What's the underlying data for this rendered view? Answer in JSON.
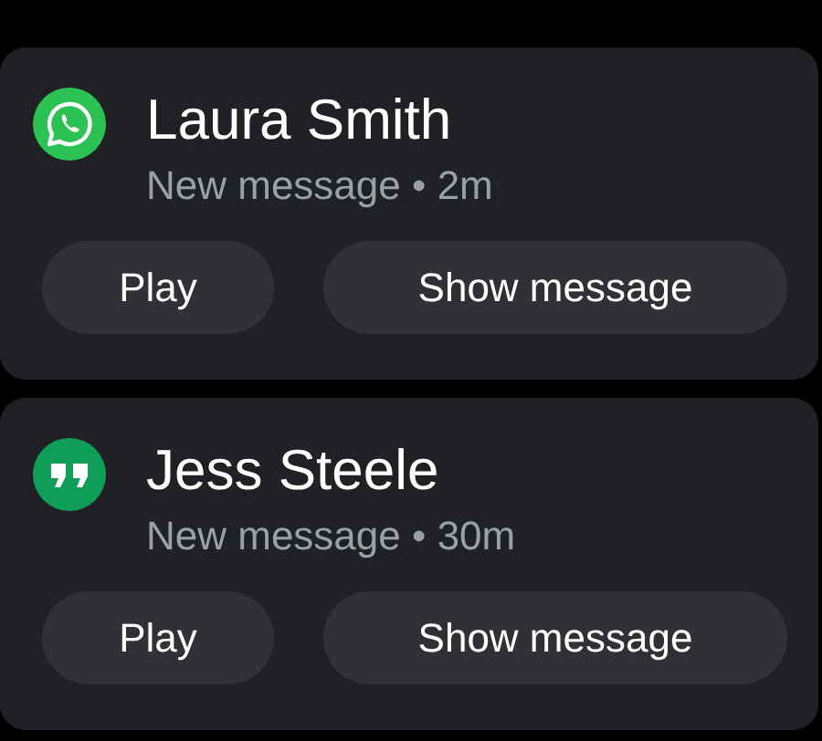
{
  "notifications": [
    {
      "kind": "phone",
      "title": "Laura Smith",
      "subtitle": "New message • 2m",
      "actions": [
        "Play",
        "Show message"
      ]
    },
    {
      "kind": "quote",
      "title": "Jess Steele",
      "subtitle": "New message • 30m",
      "actions": [
        "Play",
        "Show message"
      ]
    }
  ]
}
